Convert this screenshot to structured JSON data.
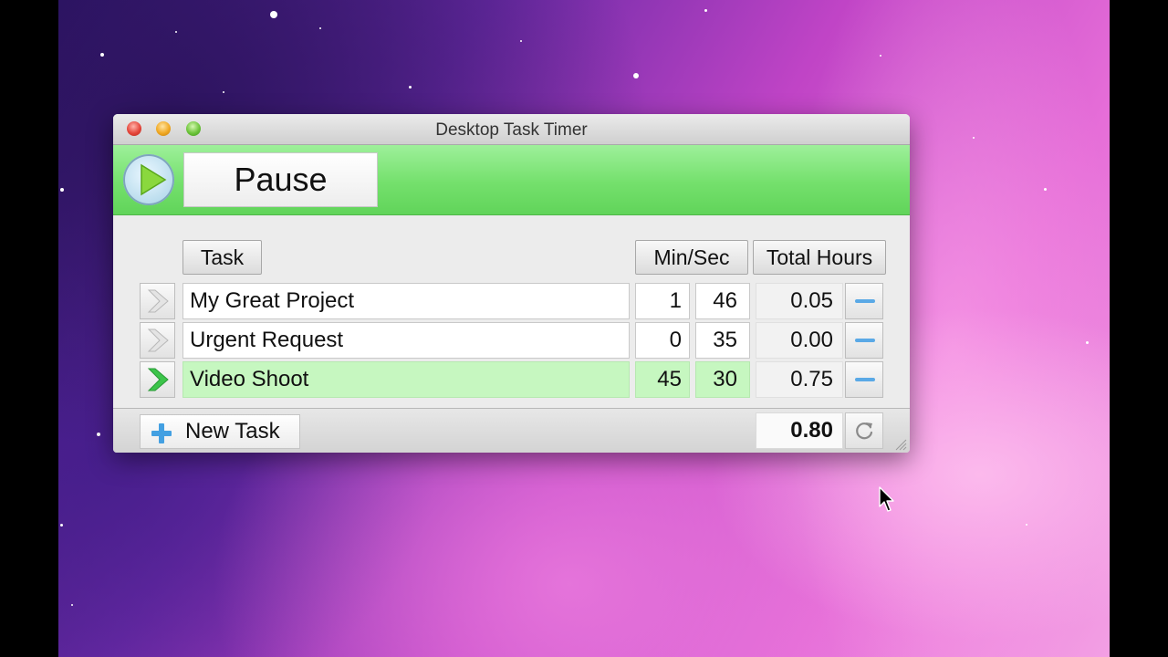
{
  "window": {
    "title": "Desktop Task Timer"
  },
  "toolbar": {
    "pause_label": "Pause"
  },
  "columns": {
    "task": "Task",
    "min_sec": "Min/Sec",
    "total_hours": "Total Hours"
  },
  "tasks": [
    {
      "name": "My Great Project",
      "minutes": "1",
      "seconds": "46",
      "hours": "0.05",
      "active": false
    },
    {
      "name": "Urgent Request",
      "minutes": "0",
      "seconds": "35",
      "hours": "0.00",
      "active": false
    },
    {
      "name": "Video Shoot",
      "minutes": "45",
      "seconds": "30",
      "hours": "0.75",
      "active": true
    }
  ],
  "footer": {
    "new_task_label": "New Task",
    "total": "0.80"
  },
  "icons": {
    "play": "play-icon",
    "task_arrow": "chevron-right-icon",
    "remove": "minus-icon",
    "add": "plus-icon",
    "reset": "refresh-icon",
    "resize": "resize-grip-icon",
    "cursor": "mouse-cursor"
  },
  "colors": {
    "active_green": "#74e06c",
    "active_row": "#c6f7c0",
    "accent_blue": "#43a0e2",
    "close": "#e5463b",
    "minimize": "#f0a823",
    "zoom": "#6cc43a"
  }
}
